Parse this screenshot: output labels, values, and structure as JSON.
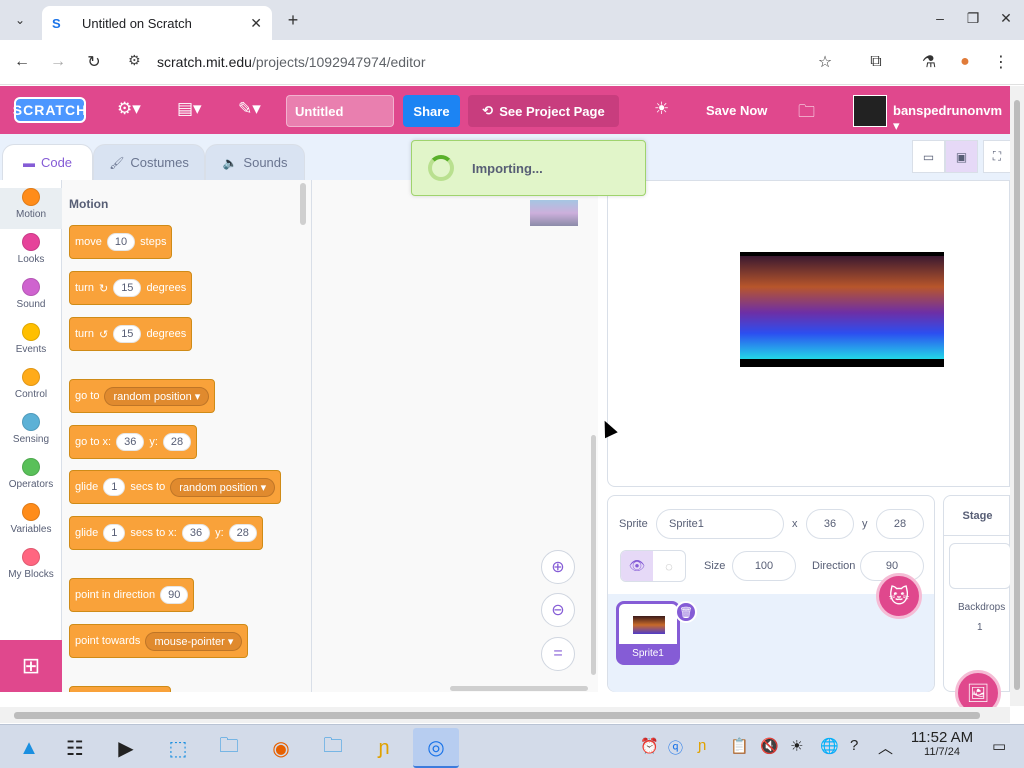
{
  "browser": {
    "tab_title": "Untitled on Scratch",
    "url_host": "scratch.mit.edu",
    "url_path": "/projects/1092947974/editor"
  },
  "menubar": {
    "logo": "SCRATCH",
    "project_title": "Untitled",
    "share": "Share",
    "see_project_page": "See Project Page",
    "save_now": "Save Now",
    "username": "banspedrunonvm"
  },
  "tabs": [
    {
      "label": "Code",
      "icon": "code-icon"
    },
    {
      "label": "Costumes",
      "icon": "brush-icon"
    },
    {
      "label": "Sounds",
      "icon": "speaker-icon"
    }
  ],
  "categories": [
    {
      "label": "Motion",
      "color": "#ff8c1a"
    },
    {
      "label": "Looks",
      "color": "#e6439a"
    },
    {
      "label": "Sound",
      "color": "#cf63cf"
    },
    {
      "label": "Events",
      "color": "#ffbf00"
    },
    {
      "label": "Control",
      "color": "#ffab19"
    },
    {
      "label": "Sensing",
      "color": "#5cb1d6"
    },
    {
      "label": "Operators",
      "color": "#59c059"
    },
    {
      "label": "Variables",
      "color": "#ff8c1a"
    },
    {
      "label": "My Blocks",
      "color": "#ff6680"
    }
  ],
  "palette": {
    "section_title": "Motion",
    "blocks": {
      "move_a": "move",
      "move_val": "10",
      "move_b": "steps",
      "turn_a": "turn",
      "turn_cw_val": "15",
      "turn_b": "degrees",
      "turn_ccw_val": "15",
      "goto_a": "go to",
      "goto_dd": "random position",
      "gotoxy_a": "go to x:",
      "gotoxy_x": "36",
      "gotoxy_y_label": "y:",
      "gotoxy_y": "28",
      "glide_a": "glide",
      "glide_secs": "1",
      "glide_b": "secs to",
      "glide_dd": "random position",
      "glidexy_a": "glide",
      "glidexy_secs": "1",
      "glidexy_b": "secs to x:",
      "glidexy_x": "36",
      "glidexy_y_label": "y:",
      "glidexy_y": "28",
      "point_dir_a": "point in direction",
      "point_dir_val": "90",
      "point_tow_a": "point towards",
      "point_tow_dd": "mouse-pointer"
    }
  },
  "alert": {
    "text": "Importing..."
  },
  "sprite_info": {
    "sprite_label": "Sprite",
    "sprite_name": "Sprite1",
    "x_label": "x",
    "x": "36",
    "y_label": "y",
    "y": "28",
    "show_label": "Show",
    "size_label": "Size",
    "size": "100",
    "direction_label": "Direction",
    "direction": "90"
  },
  "sprites": [
    {
      "name": "Sprite1"
    }
  ],
  "stage_pane": {
    "title": "Stage",
    "backdrops_label": "Backdrops",
    "backdrops_count": "1"
  },
  "taskbar": {
    "time": "11:52 AM",
    "date": "11/7/24"
  }
}
